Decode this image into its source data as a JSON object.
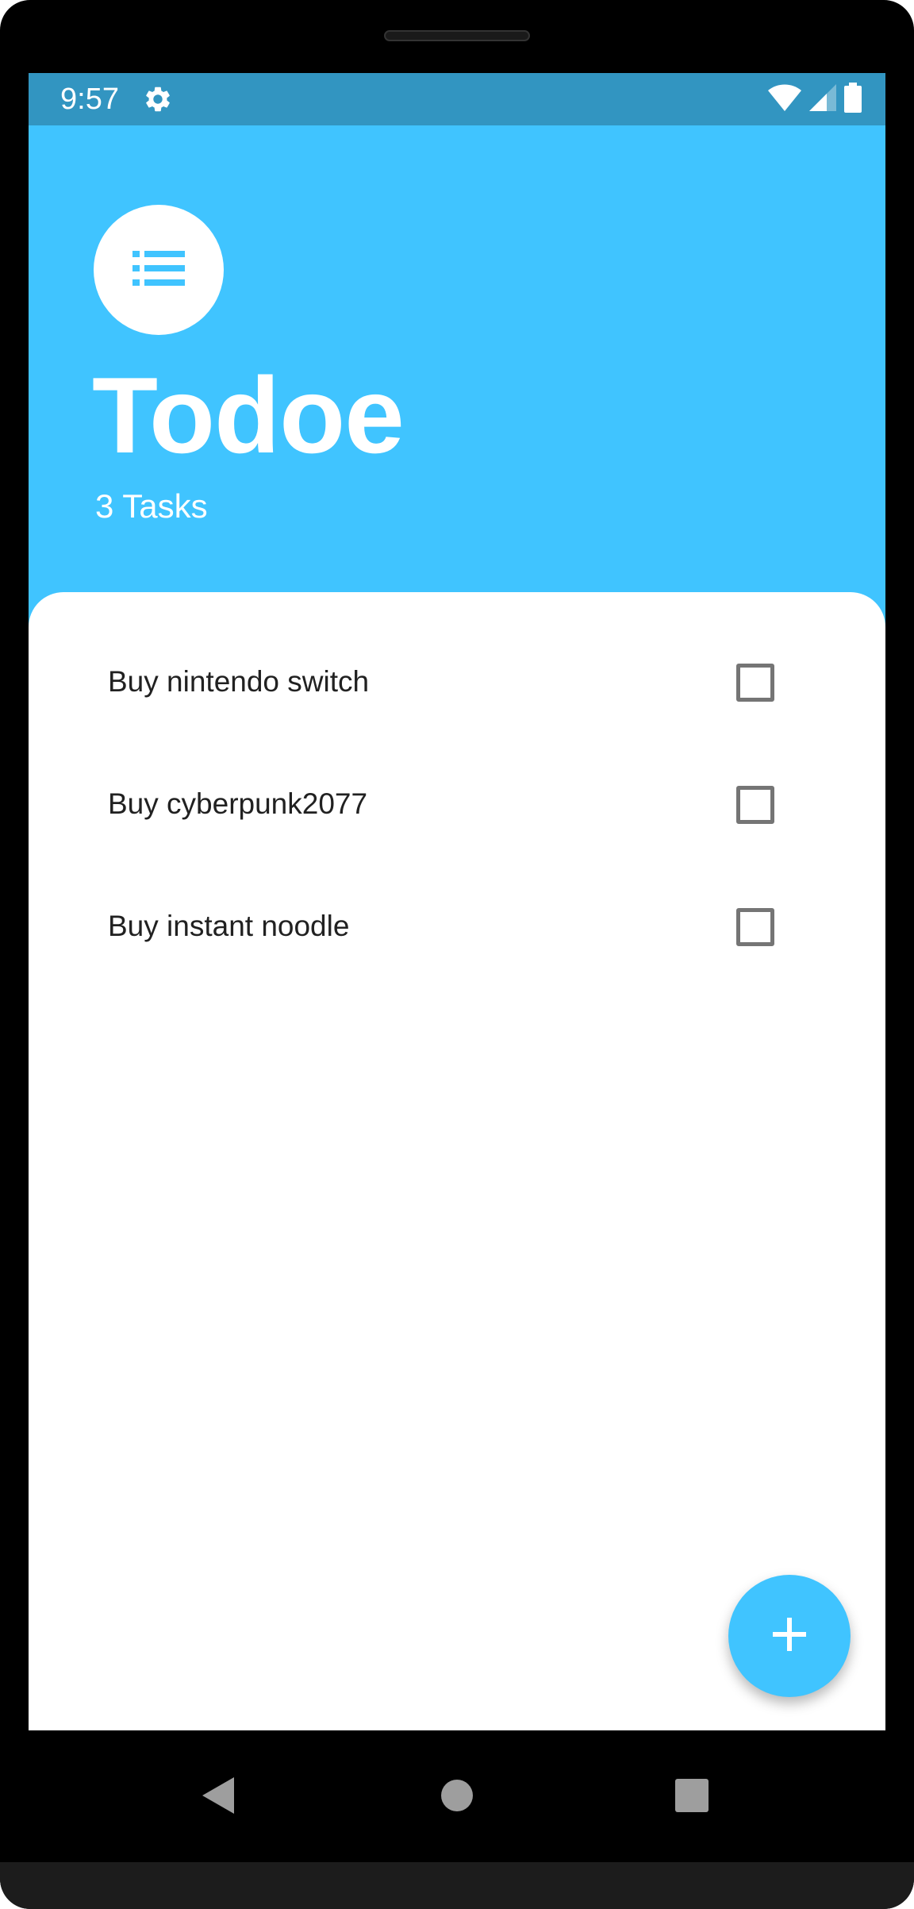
{
  "status_bar": {
    "time": "9:57",
    "icons": [
      "gear-icon",
      "wifi-icon",
      "cellular-signal-icon",
      "battery-icon"
    ]
  },
  "header": {
    "logo_icon": "list-icon",
    "title": "Todoe",
    "task_count": "3 Tasks"
  },
  "tasks": [
    {
      "label": "Buy nintendo switch",
      "checked": false
    },
    {
      "label": "Buy cyberpunk2077",
      "checked": false
    },
    {
      "label": "Buy instant noodle",
      "checked": false
    }
  ],
  "fab": {
    "icon": "plus-icon"
  },
  "nav_bar": {
    "icons": [
      "back-icon",
      "home-icon",
      "recents-icon"
    ]
  },
  "colors": {
    "accent": "#40c4ff",
    "status_bar": "#3295c1",
    "text": "#212121",
    "checkbox_border": "#757575"
  }
}
